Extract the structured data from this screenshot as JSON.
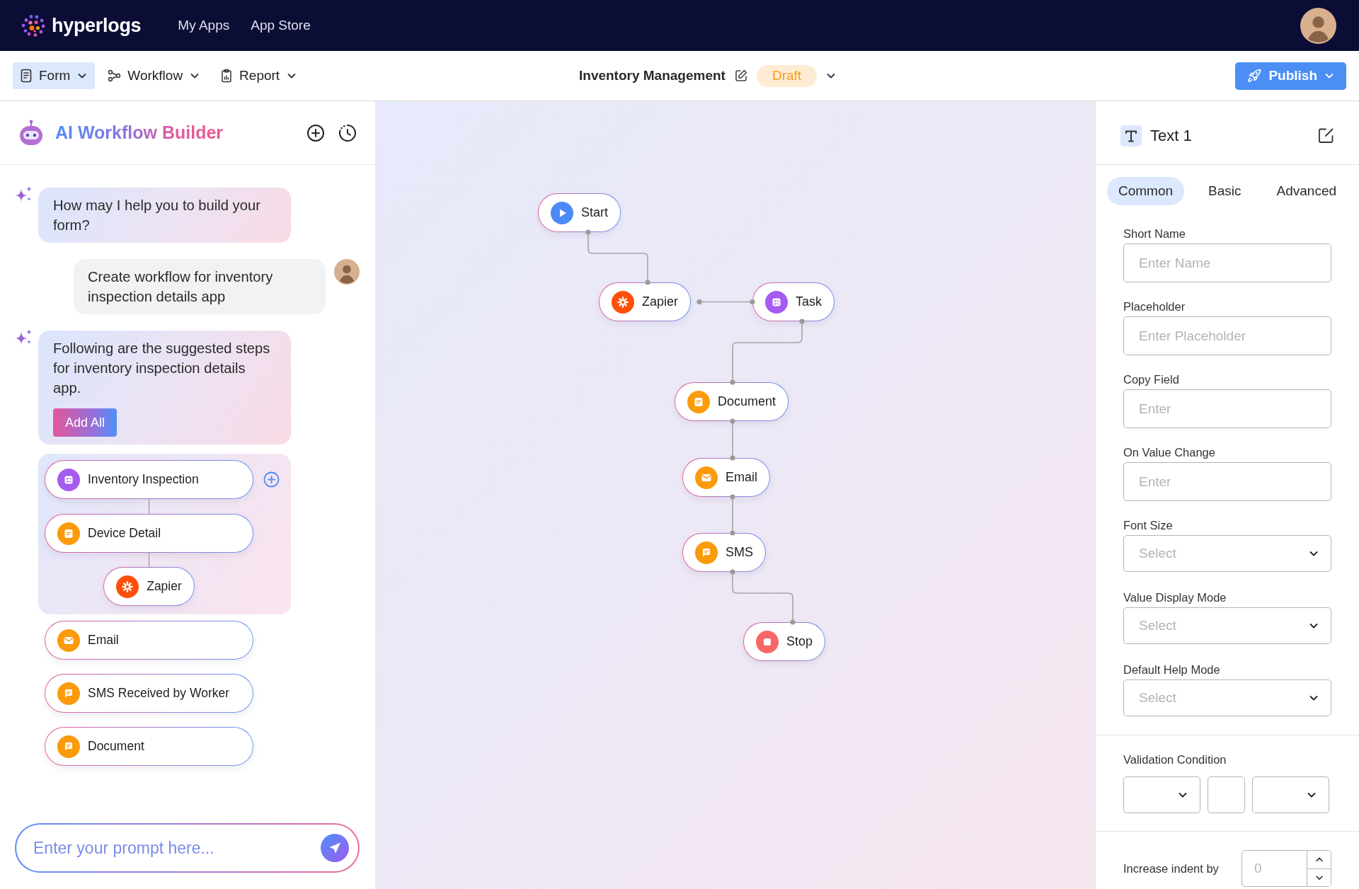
{
  "top_nav": {
    "brand": "hyperlogs",
    "links": [
      "My Apps",
      "App Store"
    ]
  },
  "toolbar": {
    "menus": [
      {
        "label": "Form",
        "kind": "form",
        "selected": true
      },
      {
        "label": "Workflow",
        "kind": "workflow",
        "selected": false
      },
      {
        "label": "Report",
        "kind": "report",
        "selected": false
      }
    ],
    "app_title": "Inventory Management",
    "status": "Draft",
    "publish": "Publish"
  },
  "ai_panel": {
    "title": "AI Workflow Builder",
    "messages": [
      {
        "kind": "assistant",
        "text": "How may I help you to build your form?"
      },
      {
        "kind": "user",
        "text": "Create workflow for inventory inspection details app"
      },
      {
        "kind": "assistant",
        "text": "Following are the suggested steps for inventory inspection details app.",
        "button": "Add All"
      }
    ],
    "suggested_group": [
      {
        "label": "Inventory Inspection",
        "kind": "checklist"
      },
      {
        "label": "Device Detail",
        "kind": "note",
        "children": [
          {
            "label": "Zapier",
            "kind": "asterisk"
          }
        ]
      }
    ],
    "suggested_steps": [
      {
        "label": "Email",
        "kind": "envelope"
      },
      {
        "label": "SMS Received by Worker",
        "kind": "chat"
      },
      {
        "label": "Document",
        "kind": "chat"
      }
    ],
    "prompt": {
      "placeholder": "Enter your prompt here..."
    }
  },
  "canvas": {
    "nodes": [
      {
        "label": "Start",
        "kind": "play"
      },
      {
        "label": "Zapier",
        "kind": "asterisk"
      },
      {
        "label": "Task",
        "kind": "checklist"
      },
      {
        "label": "Document",
        "kind": "note"
      },
      {
        "label": "Email",
        "kind": "envelope"
      },
      {
        "label": "SMS",
        "kind": "chat"
      },
      {
        "label": "Stop",
        "kind": "stop"
      }
    ]
  },
  "properties": {
    "title": "Text 1",
    "tabs": [
      {
        "label": "Common",
        "selected": true
      },
      {
        "label": "Basic",
        "selected": false
      },
      {
        "label": "Advanced",
        "selected": false
      }
    ],
    "fields": [
      {
        "label": "Short Name",
        "kind": "input",
        "placeholder": "Enter Name"
      },
      {
        "label": "Placeholder",
        "kind": "input",
        "placeholder": "Enter Placeholder"
      },
      {
        "label": "Copy Field",
        "kind": "input",
        "placeholder": "Enter"
      },
      {
        "label": "On Value Change",
        "kind": "input",
        "placeholder": "Enter"
      },
      {
        "label": "Font Size",
        "kind": "select",
        "placeholder": "Select"
      },
      {
        "label": "Value Display Mode",
        "kind": "select",
        "placeholder": "Select"
      },
      {
        "label": "Default Help Mode",
        "kind": "select",
        "placeholder": "Select"
      }
    ],
    "validation": {
      "label": "Validation Condition",
      "controls": [
        {
          "kind": "select"
        },
        {
          "kind": "input"
        },
        {
          "kind": "select"
        }
      ]
    },
    "indent": {
      "label": "Increase indent by",
      "placeholder": "0"
    }
  }
}
